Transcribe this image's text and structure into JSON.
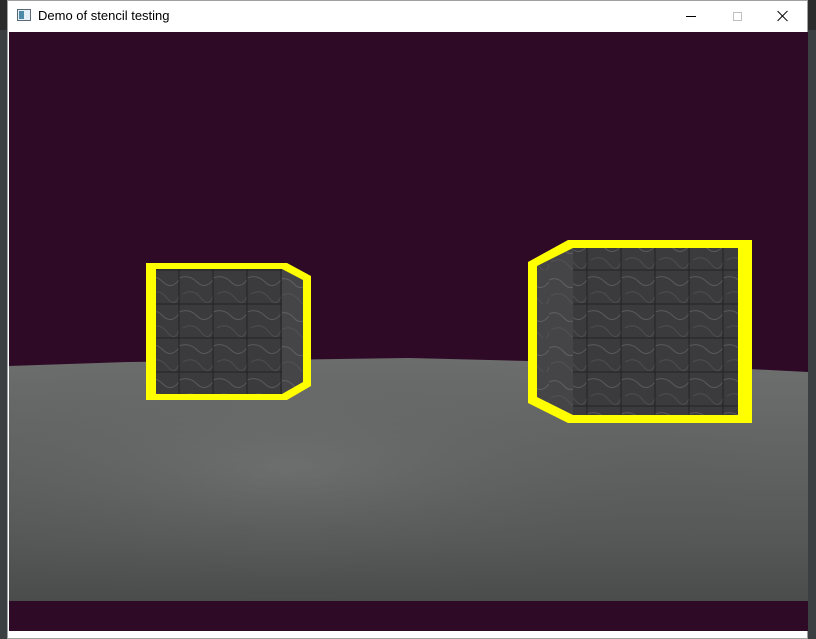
{
  "window": {
    "title": "Demo of stencil testing",
    "icon": "app-window-icon",
    "controls": {
      "minimize": "minimize-icon",
      "maximize": "maximize-icon",
      "close": "close-icon"
    }
  },
  "scene": {
    "clear_color": "#2e0a26",
    "outline_color": "#ffff00",
    "floor_color": "#5a5c5c",
    "cube_color": "#3a3a3a",
    "cubes": [
      {
        "name": "left-cube",
        "outlined": true
      },
      {
        "name": "right-cube",
        "outlined": true
      }
    ]
  }
}
